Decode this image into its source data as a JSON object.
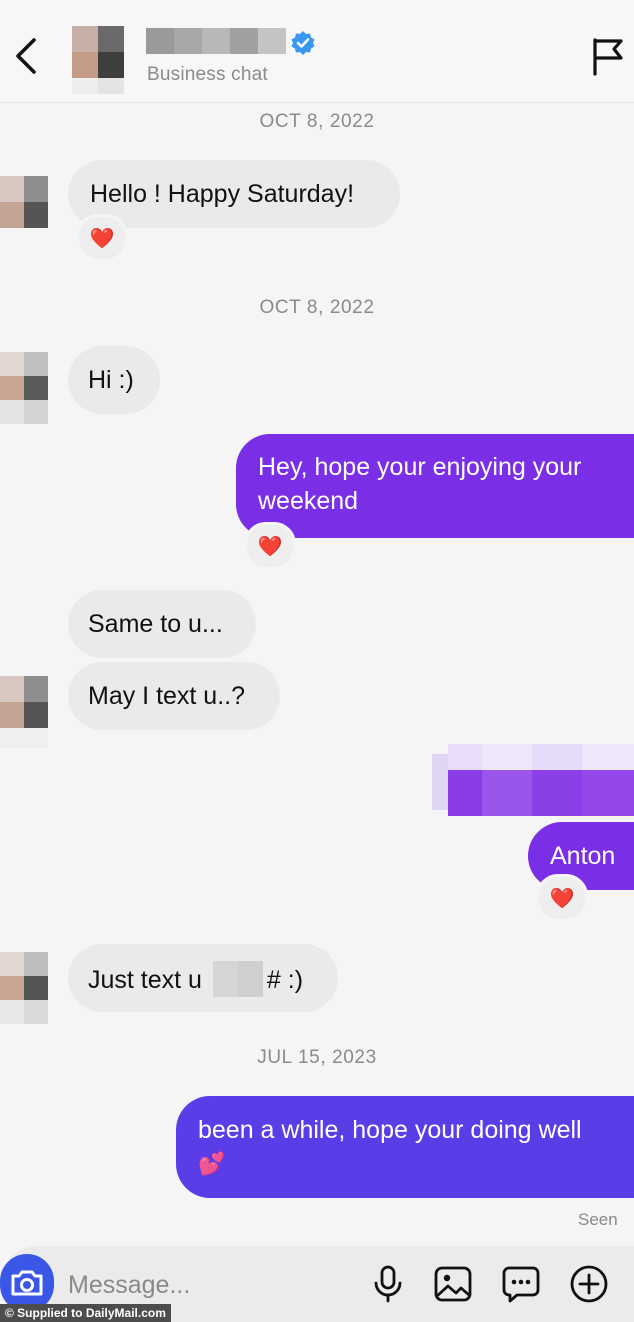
{
  "header": {
    "subtitle": "Business chat"
  },
  "conversation": {
    "date_1": "OCT 8, 2022",
    "msg_hello": "Hello ! Happy Saturday!",
    "date_2": "OCT 8, 2022",
    "msg_hi": "Hi :)",
    "msg_hey_line1": "Hey, hope your enjoying your",
    "msg_hey_line2": "weekend",
    "msg_same": "Same to u...",
    "msg_may": "May I text u..?",
    "msg_anton": "Anton",
    "msg_just_prefix": "Just text u",
    "msg_just_suffix": "# :)",
    "date_3": "JUL 15, 2023",
    "msg_been_line1": "been a while, hope your doing well",
    "msg_been_emoji": "💕",
    "reaction_emoji": "❤️",
    "seen_label": "Seen"
  },
  "composer": {
    "placeholder": "Message..."
  },
  "watermark": "© Supplied to DailyMail.com",
  "colors": {
    "outgoing_purple": "#7a2ee6",
    "outgoing_indigo": "#5b3de8",
    "incoming_bubble": "#eaeaea",
    "camera_button": "#3a57e8",
    "verified_badge": "#3897f0"
  }
}
